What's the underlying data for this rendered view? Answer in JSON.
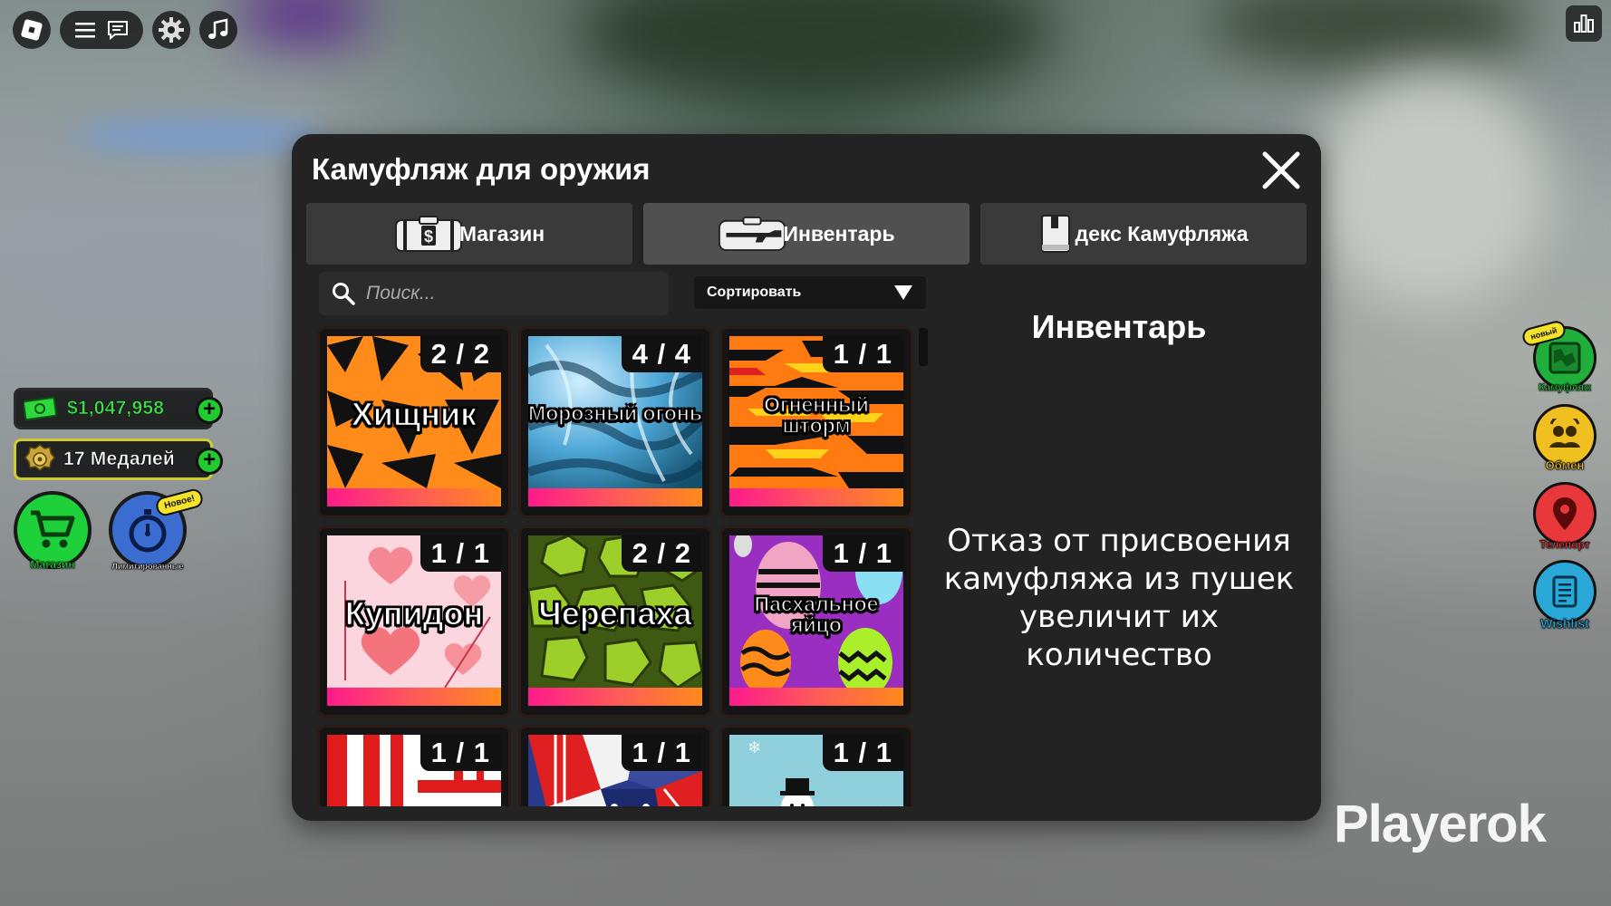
{
  "hud": {
    "money": "$1,047,958",
    "medals": "17 Медалей",
    "shop_label": "Магазин",
    "limited_label": "Лимитированные",
    "limited_badge": "Новое!",
    "right_buttons": [
      {
        "label": "Камуфляж",
        "badge": "новый",
        "color": "#1fbf3a"
      },
      {
        "label": "Обмен",
        "color": "#f0c020"
      },
      {
        "label": "Телепорт",
        "color": "#e8383c"
      },
      {
        "label": "Wishlist",
        "color": "#2aa8d8"
      }
    ]
  },
  "modal": {
    "title": "Камуфляж для оружия",
    "tabs": [
      {
        "label": "Магазин",
        "icon": "cash-case-icon"
      },
      {
        "label": "Инвентарь",
        "icon": "gun-case-icon",
        "active": true
      },
      {
        "label": "декс Камуфляжа",
        "icon": "book-icon"
      }
    ],
    "search_placeholder": "Поиск...",
    "sort_label": "Сортировать",
    "side_title": "Инвентарь",
    "side_desc": "Отказ от присвоения камуфляжа из пушек увеличит их количество"
  },
  "cards": [
    {
      "name": "Хищник",
      "count": "2 / 2",
      "pattern": "tiger"
    },
    {
      "name": "Морозный огонь",
      "count": "4 / 4",
      "pattern": "frost"
    },
    {
      "name": "Огненный шторм",
      "count": "1 / 1",
      "pattern": "firestorm"
    },
    {
      "name": "Купидон",
      "count": "1 / 1",
      "pattern": "cupid"
    },
    {
      "name": "Черепаха",
      "count": "2 / 2",
      "pattern": "turtle"
    },
    {
      "name": "Пасхальное яйцо",
      "count": "1 / 1",
      "pattern": "easter"
    },
    {
      "name": "",
      "count": "1 / 1",
      "pattern": "stripes"
    },
    {
      "name": "",
      "count": "1 / 1",
      "pattern": "usa"
    },
    {
      "name": "",
      "count": "1 / 1",
      "pattern": "snowman"
    }
  ],
  "watermark": "Playerok"
}
